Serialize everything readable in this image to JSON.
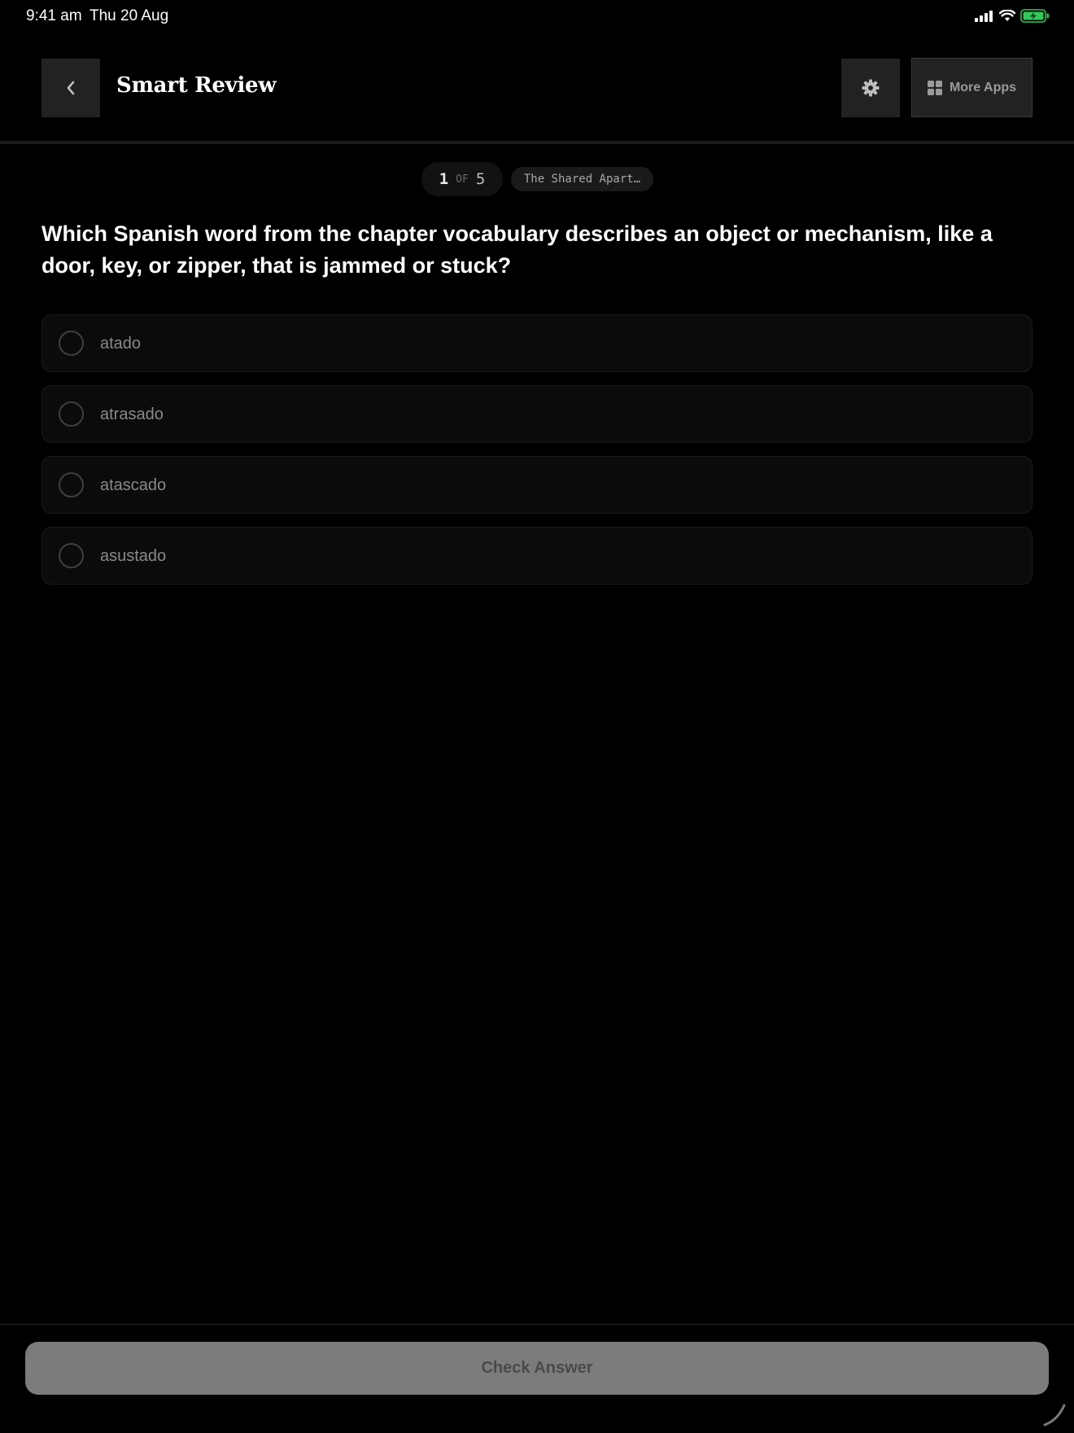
{
  "status_bar": {
    "time": "9:41 am",
    "date": "Thu 20 Aug",
    "icons": [
      "cellular-signal-icon",
      "wifi-icon",
      "battery-charging-icon"
    ],
    "battery_color": "#34c759"
  },
  "header": {
    "back_icon": "chevron-left-icon",
    "title": "Smart Review",
    "settings_icon": "gear-icon",
    "more_apps": {
      "icon": "grid-icon",
      "label": "More Apps"
    }
  },
  "progress": {
    "current": "1",
    "of": "OF",
    "total": "5",
    "chapter": "The Shared Apart…"
  },
  "question": {
    "text": "Which Spanish word from the chapter vocabulary describes an object or mechanism, like a door, key, or zipper, that is jammed or stuck?"
  },
  "options": [
    {
      "label": "atado",
      "selected": false
    },
    {
      "label": "atrasado",
      "selected": false
    },
    {
      "label": "atascado",
      "selected": false
    },
    {
      "label": "asustado",
      "selected": false
    }
  ],
  "footer": {
    "check_answer_label": "Check Answer"
  }
}
